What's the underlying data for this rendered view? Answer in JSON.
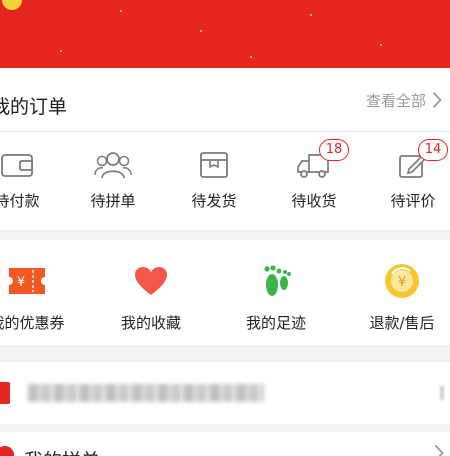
{
  "orders": {
    "title": "我的订单",
    "view_all": "查看全部",
    "items": [
      {
        "label": "待付款",
        "icon": "wallet-icon"
      },
      {
        "label": "待拼单",
        "icon": "group-users-icon"
      },
      {
        "label": "待发货",
        "icon": "package-box-icon"
      },
      {
        "label": "待收货",
        "icon": "delivery-truck-icon",
        "badge": "18"
      },
      {
        "label": "待评价",
        "icon": "edit-review-icon",
        "badge": "14"
      }
    ]
  },
  "tools": {
    "items": [
      {
        "label": "我的优惠券",
        "icon": "coupon-icon",
        "glyph": "¥"
      },
      {
        "label": "我的收藏",
        "icon": "heart-icon"
      },
      {
        "label": "我的足迹",
        "icon": "footprints-icon"
      },
      {
        "label": "退款/售后",
        "icon": "refund-coin-icon",
        "glyph": "¥"
      }
    ]
  },
  "pin": {
    "label": "我的拼单"
  },
  "colors": {
    "brand_red": "#e5261f",
    "coupon_orange": "#f2581f",
    "footprint_green": "#3bb44a",
    "refund_yellow": "#f7c52e"
  }
}
